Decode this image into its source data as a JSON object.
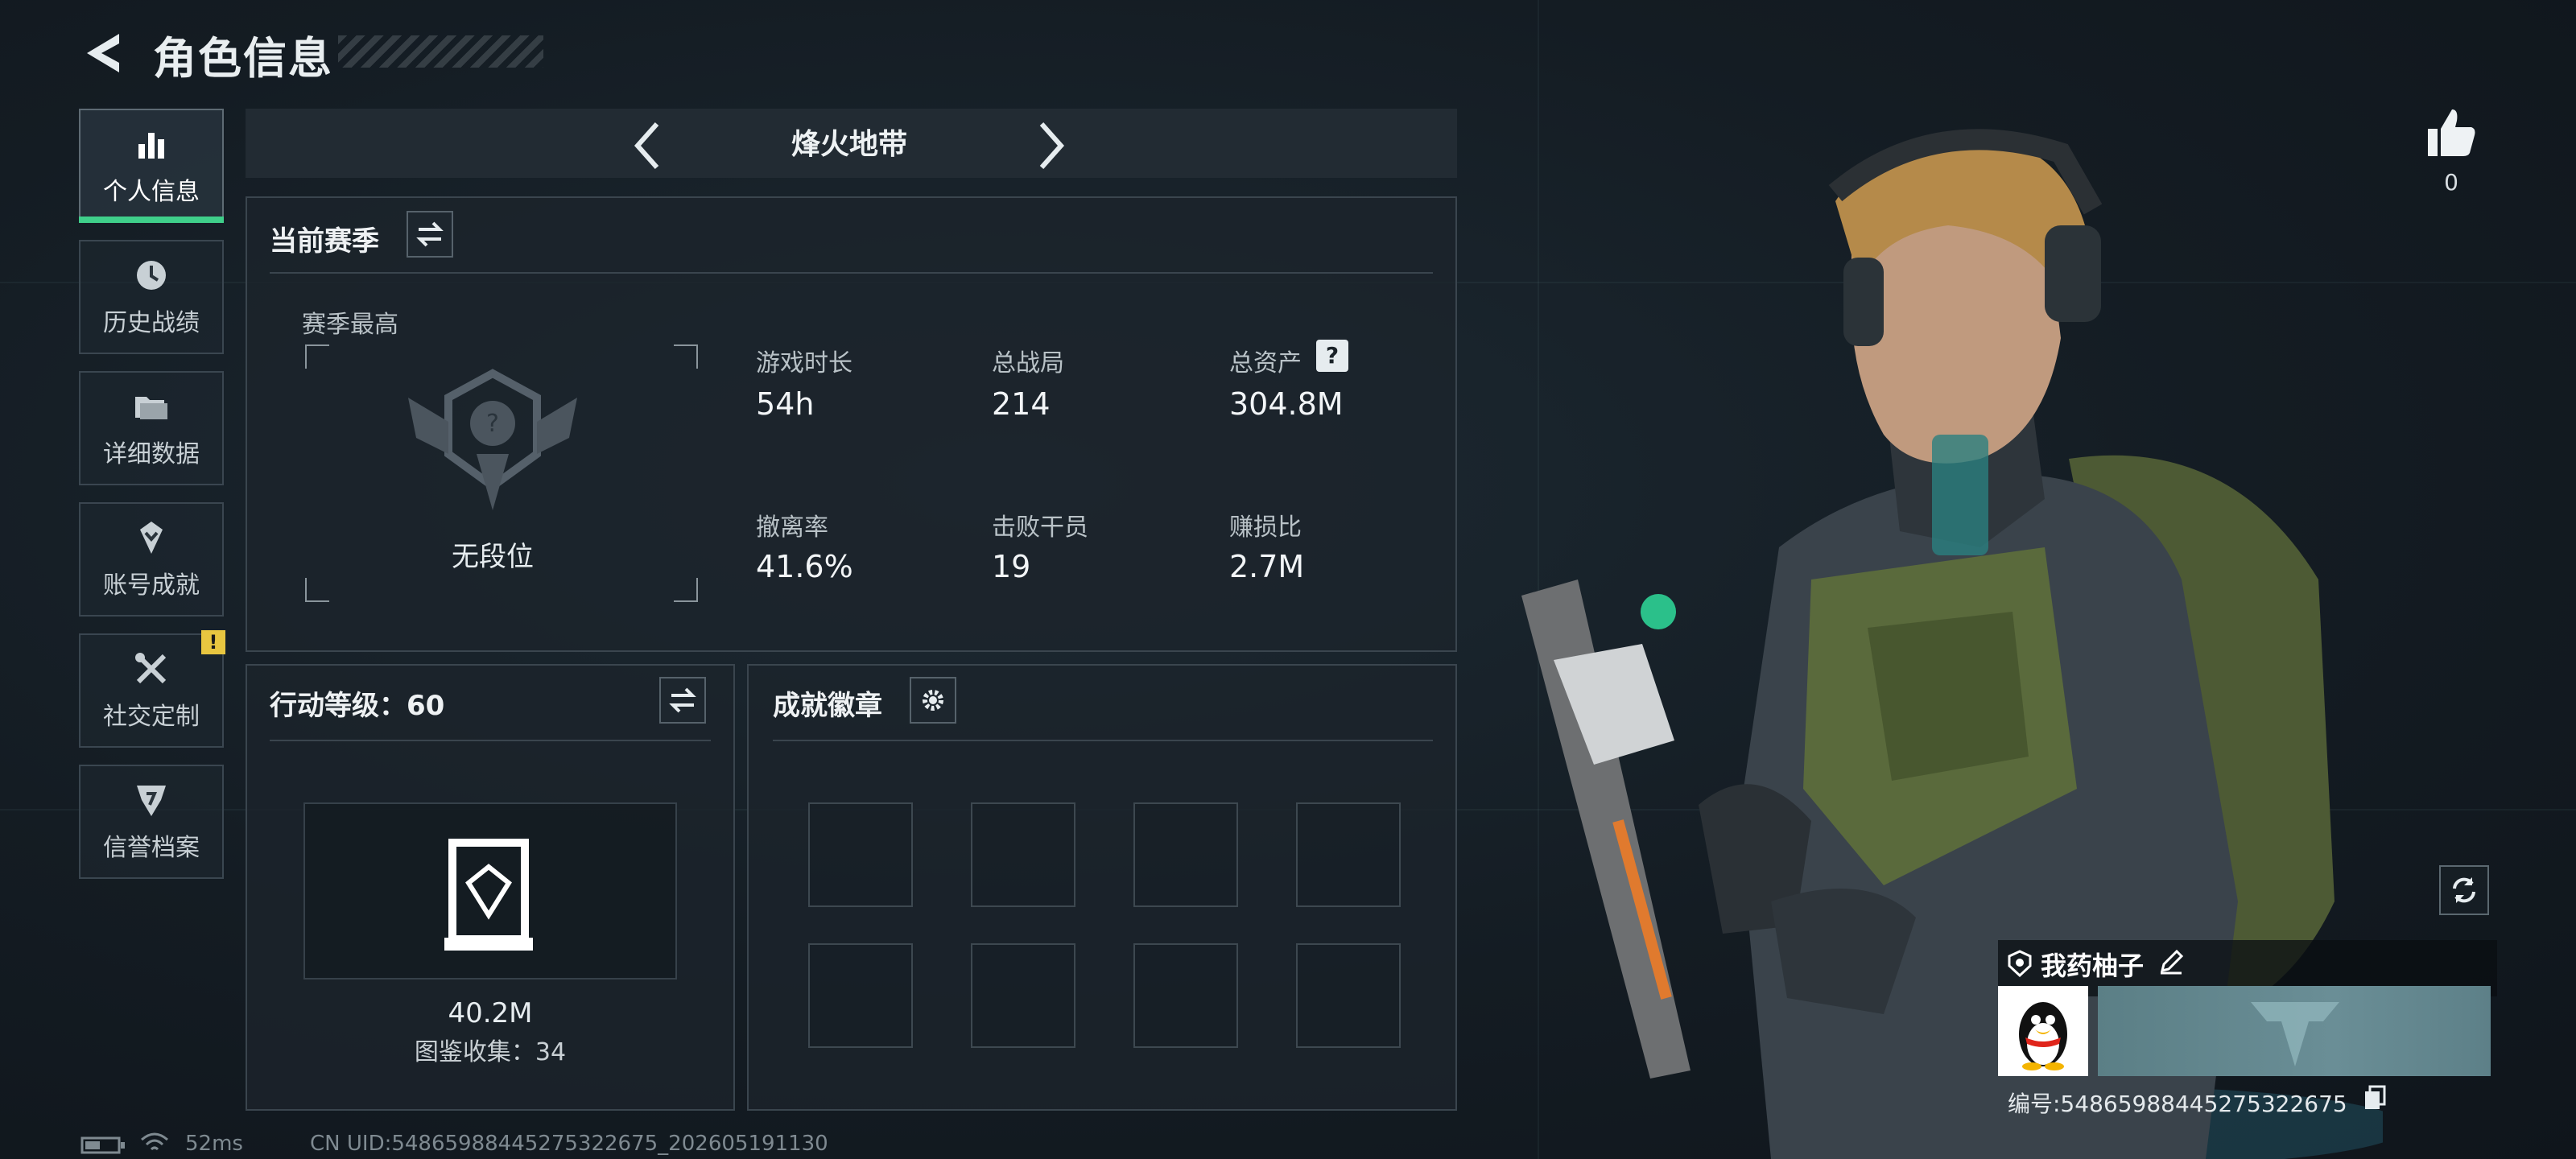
{
  "header": {
    "title": "角色信息"
  },
  "sidebar": {
    "items": [
      {
        "label": "个人信息",
        "icon": "bar-chart-icon",
        "active": true
      },
      {
        "label": "历史战绩",
        "icon": "clock-icon"
      },
      {
        "label": "详细数据",
        "icon": "folder-icon"
      },
      {
        "label": "账号成就",
        "icon": "badge-icon"
      },
      {
        "label": "社交定制",
        "icon": "tools-icon",
        "badge": "!"
      },
      {
        "label": "信誉档案",
        "icon": "shield-icon"
      }
    ]
  },
  "mode_selector": {
    "current": "烽火地带"
  },
  "season": {
    "title": "当前赛季",
    "highest_label": "赛季最高",
    "rank": "无段位",
    "rank_mark": "?",
    "stats": [
      {
        "label": "游戏时长",
        "value": "54h"
      },
      {
        "label": "总战局",
        "value": "214"
      },
      {
        "label": "总资产",
        "value": "304.8M",
        "help": "?"
      },
      {
        "label": "撤离率",
        "value": "41.6%"
      },
      {
        "label": "击败干员",
        "value": "19"
      },
      {
        "label": "赚损比",
        "value": "2.7M"
      }
    ]
  },
  "action_level": {
    "title": "行动等级：60",
    "value": "40.2M",
    "collection": "图鉴收集：34"
  },
  "achievements": {
    "title": "成就徽章",
    "slots": 8
  },
  "status_bar": {
    "ping": "52ms",
    "uid": "CN UID:5486598844527532267​5_202605191130"
  },
  "profile": {
    "likes": "0",
    "player_name": "我药柚子",
    "player_id": "编号:5486598844527532267​5"
  },
  "colors": {
    "accent": "#3fcf8a",
    "warning": "#e8c640"
  }
}
